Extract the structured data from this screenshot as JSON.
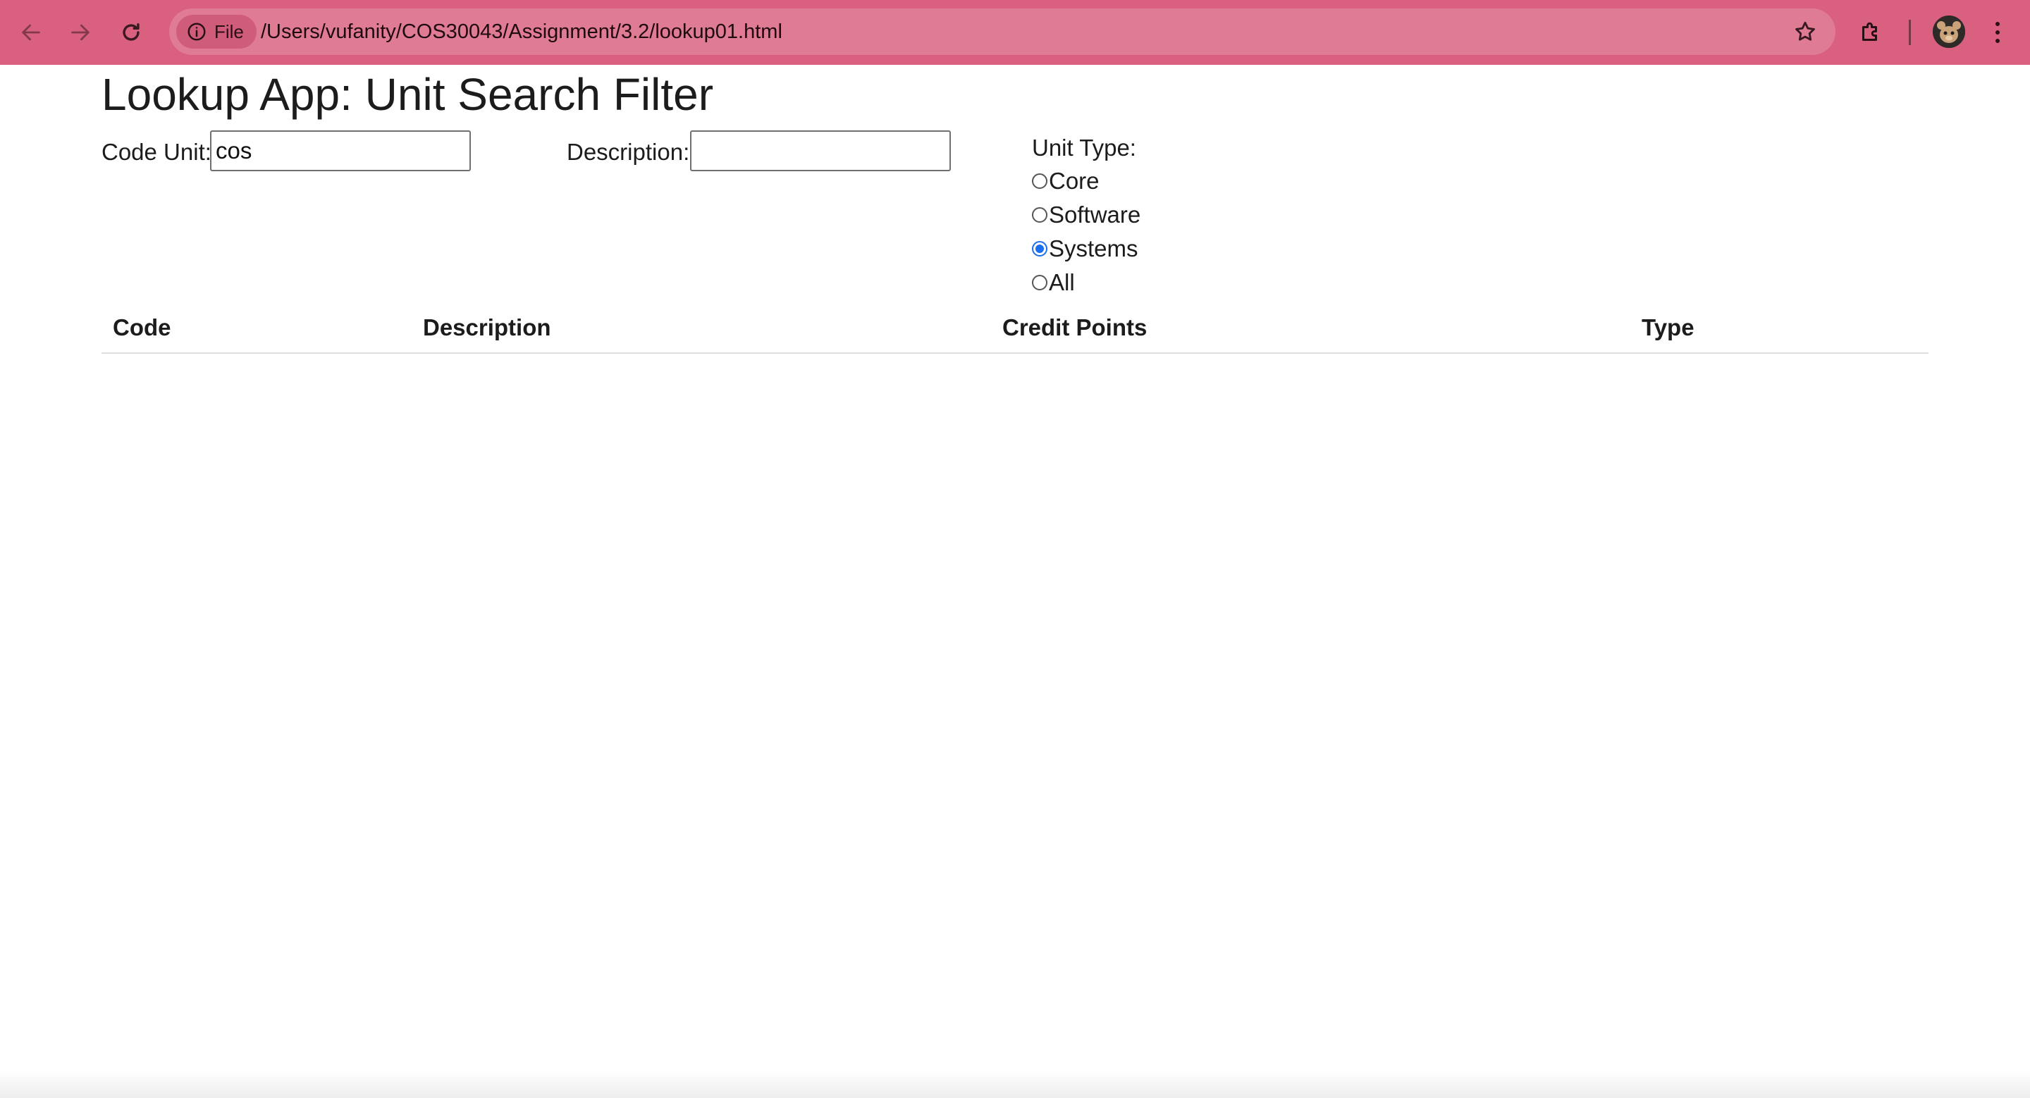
{
  "browser": {
    "site_chip_label": "File",
    "url": "/Users/vufanity/COS30043/Assignment/3.2/lookup01.html",
    "theme_color": "#d9607f"
  },
  "page": {
    "title": "Lookup App: Unit Search Filter"
  },
  "filters": {
    "code_unit": {
      "label": "Code Unit:",
      "value": "cos"
    },
    "description": {
      "label": "Description:",
      "value": ""
    },
    "unit_type": {
      "label": "Unit Type:",
      "options": [
        {
          "label": "Core",
          "checked": false
        },
        {
          "label": "Software",
          "checked": false
        },
        {
          "label": "Systems",
          "checked": true
        },
        {
          "label": "All",
          "checked": false
        }
      ],
      "selected": "Systems",
      "accent_color": "#1a6ff0"
    }
  },
  "table": {
    "columns": [
      "Code",
      "Description",
      "Credit Points",
      "Type"
    ],
    "rows": []
  }
}
